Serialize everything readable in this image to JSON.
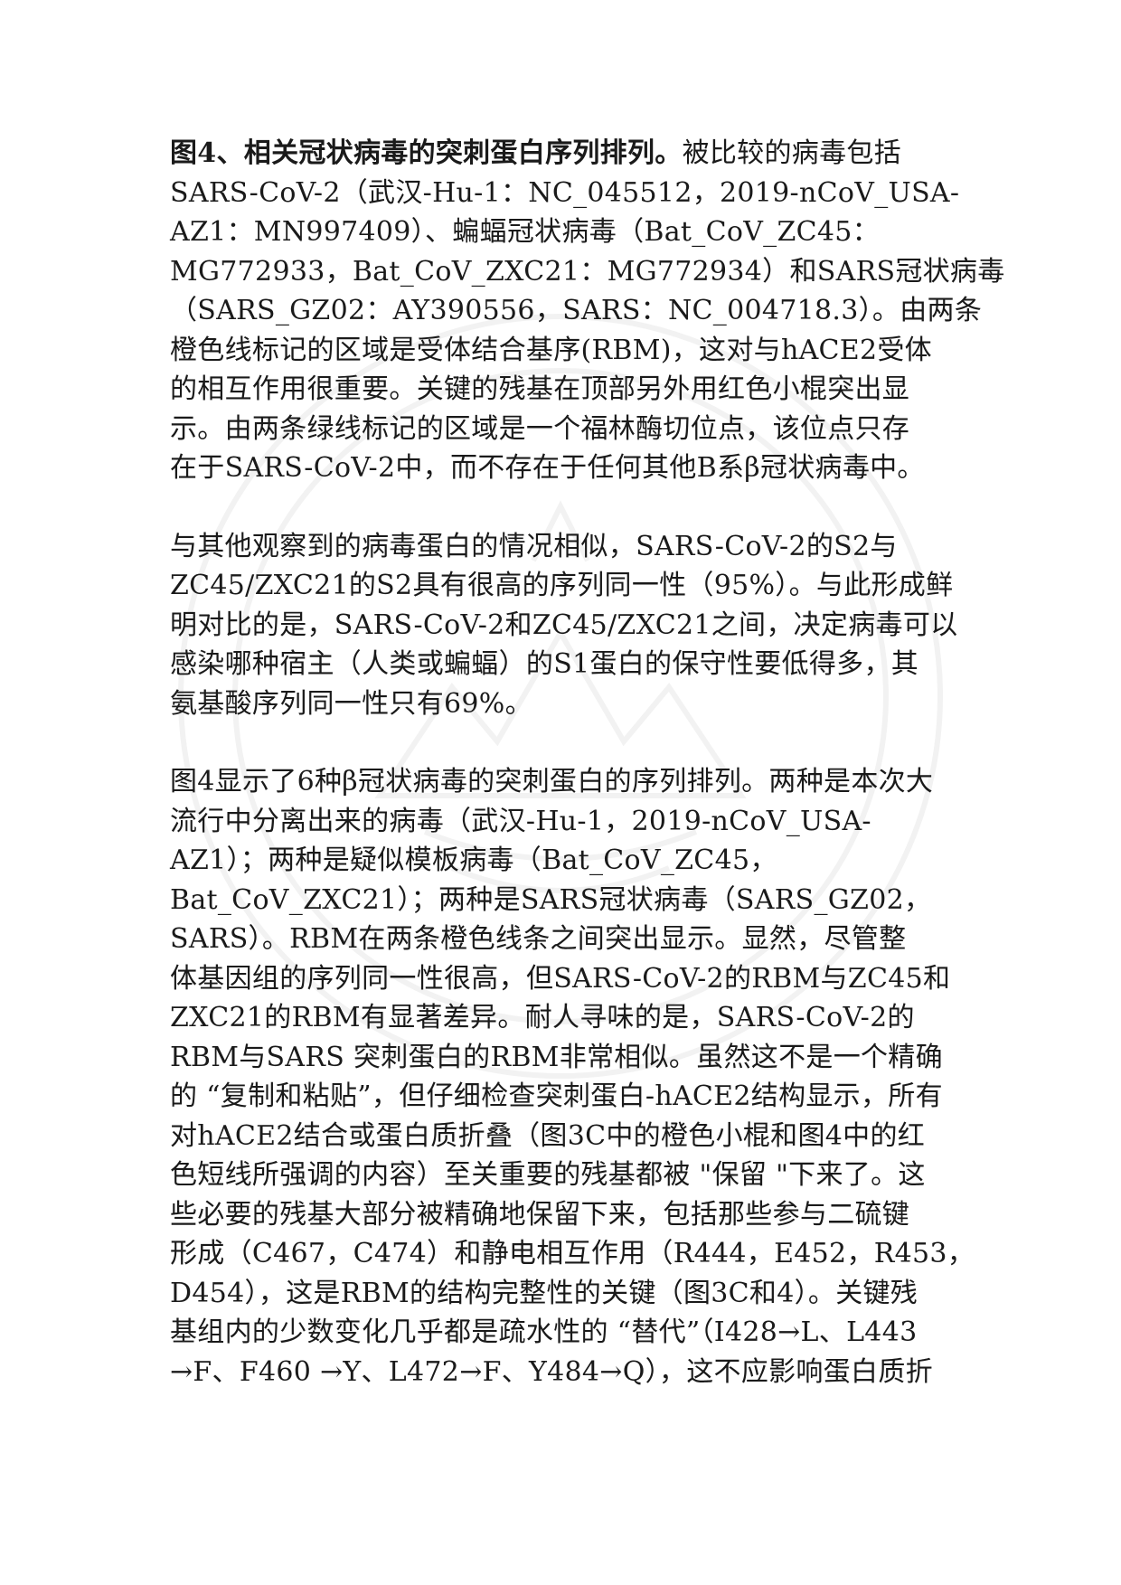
{
  "paragraph1": {
    "figure_label": "图4、相关冠状病毒的突刺蛋白序列排列。",
    "first_line_rest": "被比较的病毒包括",
    "lines": [
      "SARS-CoV-2（武汉-Hu-1：NC_045512，2019-nCoV_USA-",
      "AZ1：MN997409）、蝙蝠冠状病毒（Bat_CoV_ZC45：",
      "MG772933，Bat_CoV_ZXC21：MG772934）和SARS冠状病毒",
      "（SARS_GZ02：AY390556，SARS：NC_004718.3）。由两条",
      "橙色线标记的区域是受体结合基序(RBM)，这对与hACE2受体",
      "的相互作用很重要。关键的残基在顶部另外用红色小棍突出显",
      "示。由两条绿线标记的区域是一个福林酶切位点，该位点只存",
      "在于SARS-CoV-2中，而不存在于任何其他B系β冠状病毒中。"
    ]
  },
  "paragraph2": {
    "lines": [
      "与其他观察到的病毒蛋白的情况相似，SARS-CoV-2的S2与",
      "ZC45/ZXC21的S2具有很高的序列同一性（95%）。与此形成鲜",
      "明对比的是，SARS-CoV-2和ZC45/ZXC21之间，决定病毒可以",
      "感染哪种宿主（人类或蝙蝠）的S1蛋白的保守性要低得多，其",
      "氨基酸序列同一性只有69%。"
    ]
  },
  "paragraph3": {
    "lines": [
      "图4显示了6种β冠状病毒的突刺蛋白的序列排列。两种是本次大",
      "流行中分离出来的病毒（武汉-Hu-1，2019-nCoV_USA-",
      "AZ1）；两种是疑似模板病毒（Bat_CoV_ZC45，",
      "Bat_CoV_ZXC21）；两种是SARS冠状病毒（SARS_GZ02，",
      "SARS）。RBM在两条橙色线条之间突出显示。显然，尽管整",
      "体基因组的序列同一性很高，但SARS-CoV-2的RBM与ZC45和",
      "ZXC21的RBM有显著差异。耐人寻味的是，SARS-CoV-2的",
      "RBM与SARS 突刺蛋白的RBM非常相似。虽然这不是一个精确",
      "的 “复制和粘贴”，但仔细检查突刺蛋白-hACE2结构显示，所有",
      "对hACE2结合或蛋白质折叠（图3C中的橙色小棍和图4中的红",
      "色短线所强调的内容）至关重要的残基都被 \"保留 \"下来了。这",
      "些必要的残基大部分被精确地保留下来，包括那些参与二硫键",
      "形成（C467，C474）和静电相互作用（R444，E452，R453，",
      "D454），这是RBM的结构完整性的关键（图3C和4）。关键残",
      "基组内的少数变化几乎都是疏水性的 “替代”（I428→L、L443",
      "→F、F460 →Y、L472→F、Y484→Q），这不应影响蛋白质折"
    ]
  },
  "watermark_color": "#f1f1f1"
}
